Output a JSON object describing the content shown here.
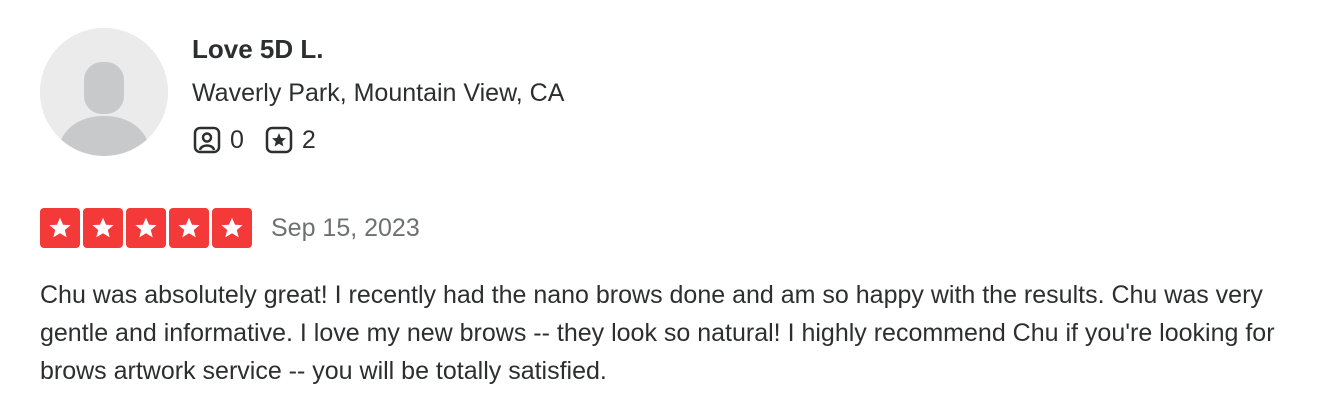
{
  "user": {
    "name": "Love 5D L.",
    "location": "Waverly Park, Mountain View, CA",
    "friends_count": "0",
    "reviews_count": "2",
    "avatar_icon": "default-user-avatar-icon",
    "friends_icon": "friends-icon",
    "reviews_icon": "review-star-icon"
  },
  "review": {
    "rating": 5,
    "rating_max": 5,
    "star_color": "#f43939",
    "date": "Sep 15, 2023",
    "text": "Chu was absolutely great! I recently had the nano brows done and am so happy with the results. Chu was very gentle and informative. I love my new brows -- they look so natural! I highly recommend Chu if you're looking for brows artwork service -- you will be totally satisfied."
  }
}
